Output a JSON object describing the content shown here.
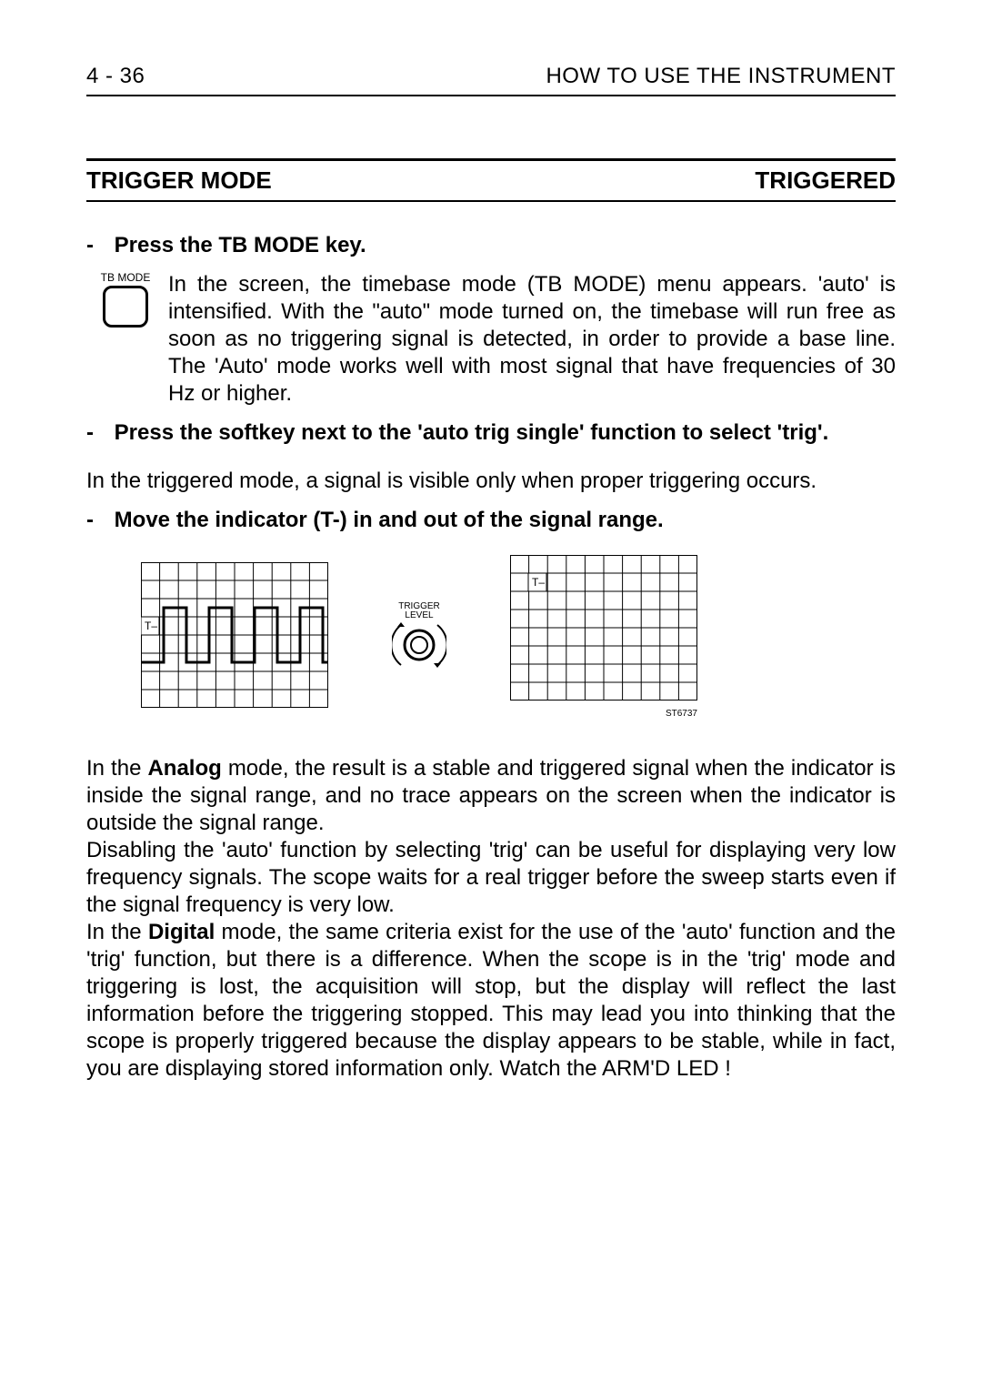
{
  "header": {
    "page_number": "4 - 36",
    "right": "HOW TO USE THE INSTRUMENT"
  },
  "section": {
    "left": "TRIGGER MODE",
    "right": "TRIGGERED"
  },
  "steps": {
    "s1_label": "Press the TB MODE key.",
    "tb_mode_caption": "TB MODE",
    "s1_body": "In the screen, the timebase mode (TB MODE) menu appears. 'auto' is intensified. With the \"auto\" mode turned on, the timebase will run free as soon as no triggering signal is detected, in order to provide a base line. The 'Auto' mode works well with most signal that have frequencies of 30 Hz or higher.",
    "s2_label": "Press the softkey next to the 'auto trig single' function to select 'trig'.",
    "s2_body": "In the triggered mode, a signal is visible only when proper triggering occurs.",
    "s3_label": "Move the indicator (T-) in and out of the signal range."
  },
  "diagram": {
    "knob_line1": "TRIGGER",
    "knob_line2": "LEVEL",
    "t_marker_left": "T–",
    "t_marker_right": "T–",
    "fig_id": "ST6737"
  },
  "body": {
    "p1_a": "In the ",
    "p1_bold1": "Analog",
    "p1_b": " mode, the result is a stable and triggered signal when the indicator is inside the signal range, and no trace appears on the screen when the indicator is outside the signal range.",
    "p2": "Disabling the 'auto' function by selecting 'trig' can be useful for displaying very low frequency signals. The scope waits for a real trigger before the sweep starts even if the signal frequency is very low.",
    "p3_a": "In the ",
    "p3_bold1": "Digital",
    "p3_b": " mode, the same criteria exist for the use of the 'auto' function and the 'trig' function, but there is a difference. When the scope is in the 'trig' mode and triggering is lost, the acquisition will stop, but the display will reflect the last information before the triggering stopped. This may lead you into thinking that the scope is properly triggered because the display appears to be stable, while in fact, you are displaying stored information only. Watch the ARM'D LED !"
  }
}
